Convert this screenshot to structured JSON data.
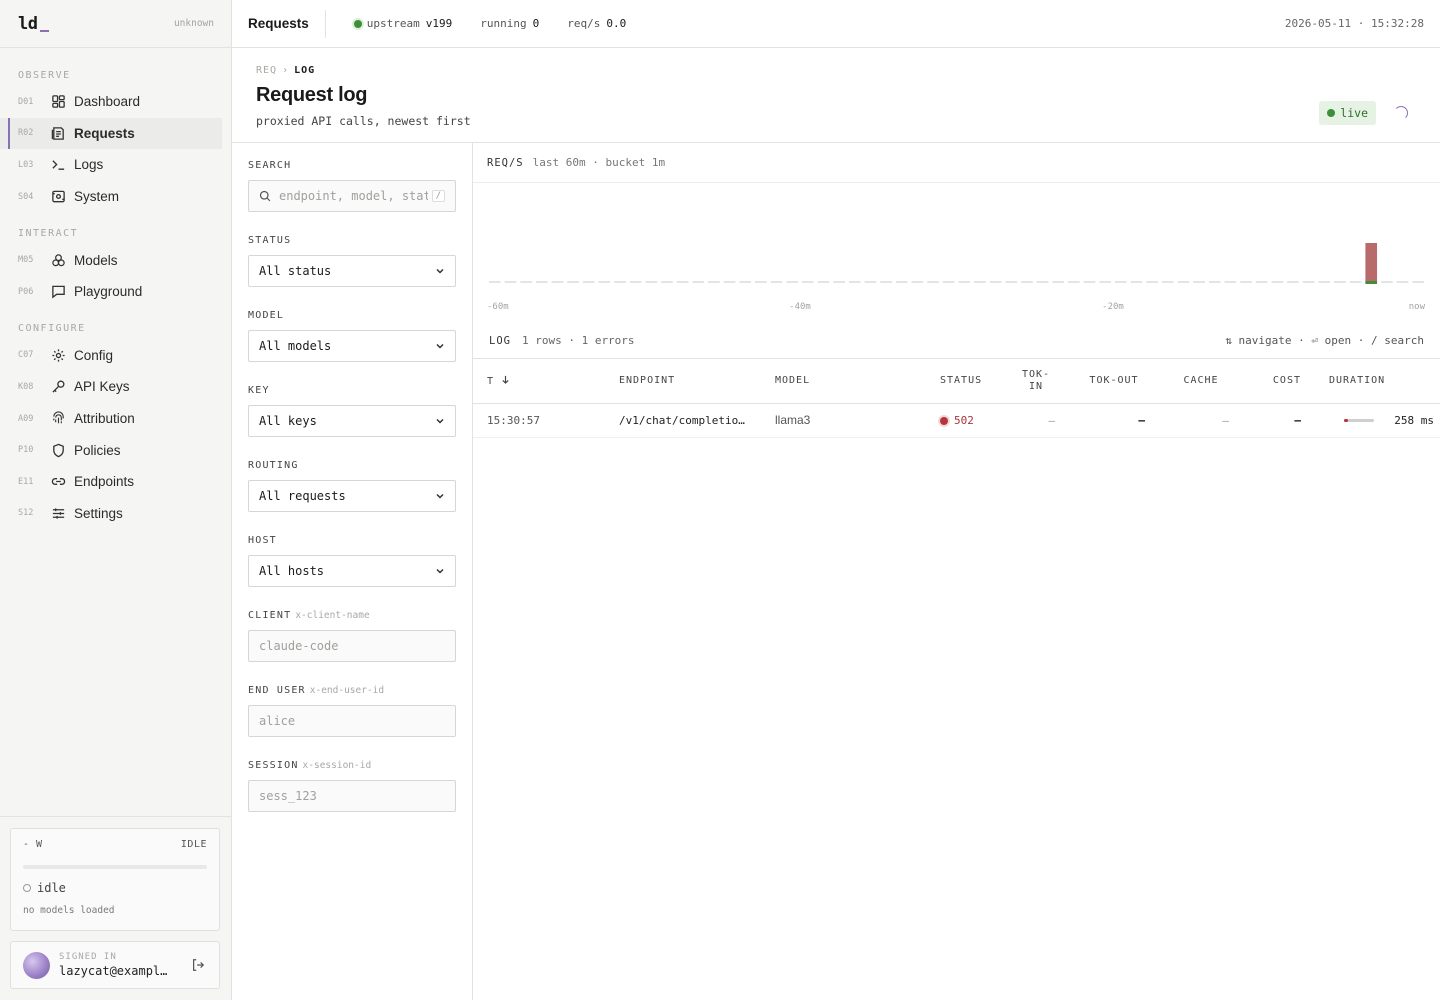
{
  "brand": {
    "logo": "ld",
    "status": "unknown"
  },
  "nav": {
    "groups": [
      {
        "label": "OBSERVE",
        "items": [
          {
            "code": "D01",
            "label": "Dashboard",
            "icon": "dashboard-icon"
          },
          {
            "code": "R02",
            "label": "Requests",
            "icon": "requests-icon",
            "active": true
          },
          {
            "code": "L03",
            "label": "Logs",
            "icon": "terminal-icon"
          },
          {
            "code": "S04",
            "label": "System",
            "icon": "system-icon"
          }
        ]
      },
      {
        "label": "INTERACT",
        "items": [
          {
            "code": "M05",
            "label": "Models",
            "icon": "models-icon"
          },
          {
            "code": "P06",
            "label": "Playground",
            "icon": "chat-icon"
          }
        ]
      },
      {
        "label": "CONFIGURE",
        "items": [
          {
            "code": "C07",
            "label": "Config",
            "icon": "gear-icon"
          },
          {
            "code": "K08",
            "label": "API Keys",
            "icon": "key-icon"
          },
          {
            "code": "A09",
            "label": "Attribution",
            "icon": "fingerprint-icon"
          },
          {
            "code": "P10",
            "label": "Policies",
            "icon": "shield-icon"
          },
          {
            "code": "E11",
            "label": "Endpoints",
            "icon": "link-icon"
          },
          {
            "code": "S12",
            "label": "Settings",
            "icon": "sliders-icon"
          }
        ]
      }
    ]
  },
  "gpu": {
    "power": "- W",
    "state": "IDLE",
    "status": "idle",
    "sub": "no models loaded"
  },
  "user": {
    "label": "SIGNED IN",
    "email": "lazycat@exampl…"
  },
  "topbar": {
    "title": "Requests",
    "upstream_label": "upstream",
    "upstream_value": "v199",
    "running_label": "running",
    "running_value": "0",
    "reqs_label": "req/s",
    "reqs_value": "0.0",
    "datetime": "2026-05-11 · 15:32:28"
  },
  "page": {
    "crumb_root": "REQ",
    "crumb_sep": "›",
    "crumb_current": "LOG",
    "title": "Request log",
    "subtitle": "proxied API calls, newest first",
    "live": "live"
  },
  "filters": {
    "search": {
      "label": "SEARCH",
      "placeholder": "endpoint, model, stat",
      "kbd": "/"
    },
    "status": {
      "label": "STATUS",
      "value": "All status"
    },
    "model": {
      "label": "MODEL",
      "value": "All models"
    },
    "key": {
      "label": "KEY",
      "value": "All keys"
    },
    "routing": {
      "label": "ROUTING",
      "value": "All requests"
    },
    "host": {
      "label": "HOST",
      "value": "All hosts"
    },
    "client": {
      "label": "CLIENT",
      "hint": "x-client-name",
      "placeholder": "claude-code"
    },
    "end_user": {
      "label": "END USER",
      "hint": "x-end-user-id",
      "placeholder": "alice"
    },
    "session": {
      "label": "SESSION",
      "hint": "x-session-id",
      "placeholder": "sess_123"
    }
  },
  "chart": {
    "label": "REQ/S",
    "meta": "last 60m · bucket 1m"
  },
  "chart_data": {
    "type": "bar",
    "xlabel": "",
    "ylabel": "",
    "x_ticks": [
      "-60m",
      "-40m",
      "-20m",
      "now"
    ],
    "bucket_count": 60,
    "series": [
      {
        "name": "",
        "color": "#b96b6b",
        "values": [
          0,
          0,
          0,
          0,
          0,
          0,
          0,
          0,
          0,
          0,
          0,
          0,
          0,
          0,
          0,
          0,
          0,
          0,
          0,
          0,
          0,
          0,
          0,
          0,
          0,
          0,
          0,
          0,
          0,
          0,
          0,
          0,
          0,
          0,
          0,
          0,
          0,
          0,
          0,
          0,
          0,
          0,
          0,
          0,
          0,
          0,
          0,
          0,
          0,
          0,
          0,
          0,
          0,
          0,
          0,
          0,
          1,
          0,
          0,
          0
        ]
      },
      {
        "name": "",
        "color": "#3f8f3a",
        "values": [
          0,
          0,
          0,
          0,
          0,
          0,
          0,
          0,
          0,
          0,
          0,
          0,
          0,
          0,
          0,
          0,
          0,
          0,
          0,
          0,
          0,
          0,
          0,
          0,
          0,
          0,
          0,
          0,
          0,
          0,
          0,
          0,
          0,
          0,
          0,
          0,
          0,
          0,
          0,
          0,
          0,
          0,
          0,
          0,
          0,
          0,
          0,
          0,
          0,
          0,
          0,
          0,
          0,
          0,
          0,
          0,
          0.08,
          0,
          0,
          0
        ]
      }
    ],
    "ylim": [
      0,
      1
    ],
    "grid": false,
    "legend": "none"
  },
  "log": {
    "label": "LOG",
    "meta": "1 rows · 1 errors",
    "shortcuts": "⇅ navigate · ⏎ open · / search",
    "columns": [
      "T",
      "ENDPOINT",
      "MODEL",
      "STATUS",
      "TOK-IN",
      "TOK-OUT",
      "CACHE",
      "COST",
      "DURATION"
    ],
    "rows": [
      {
        "time": "15:30:57",
        "endpoint": "/v1/chat/completio…",
        "model": "llama3",
        "status": "502",
        "tok_in": "—",
        "tok_out": "—",
        "cache": "—",
        "cost": "—",
        "duration": "258 ms",
        "duration_fraction": 0.12
      }
    ]
  },
  "colors": {
    "accent": "#8b6fb5",
    "ok": "#3f8f3a",
    "error": "#b4353b"
  }
}
